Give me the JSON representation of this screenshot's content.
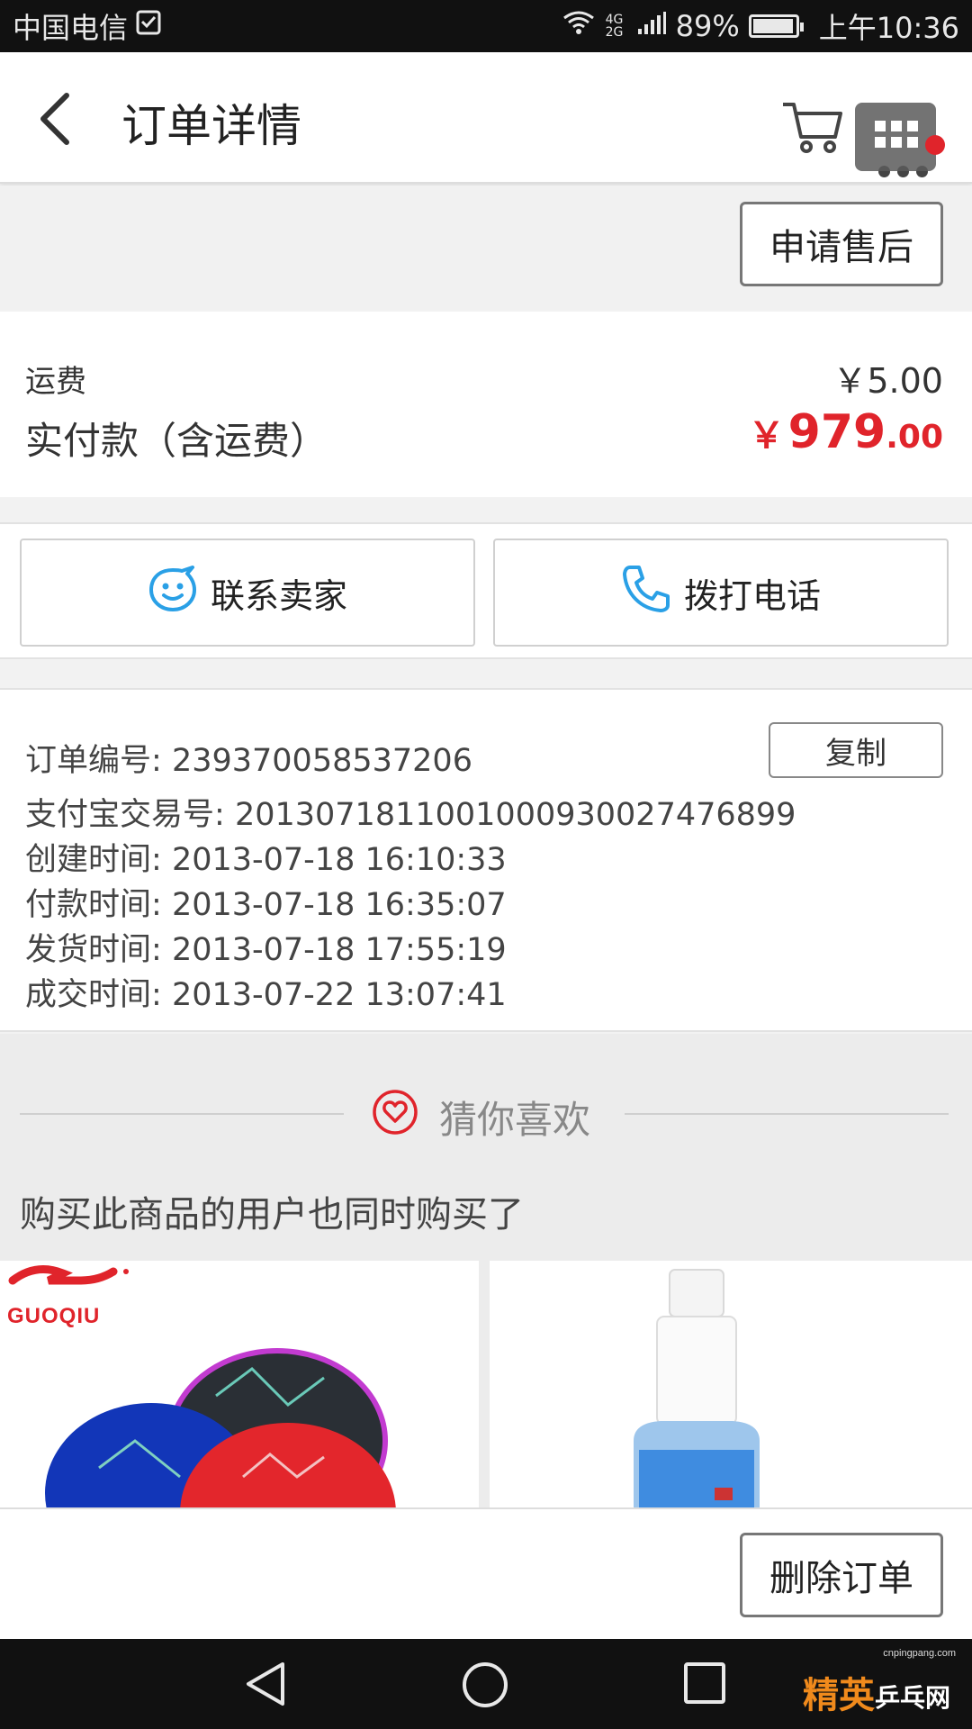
{
  "status_bar": {
    "carrier": "中国电信",
    "network": "4G 2G",
    "battery": "89%",
    "time": "上午10:36"
  },
  "header": {
    "title": "订单详情"
  },
  "actions": {
    "after_sale": "申请售后",
    "delete_order": "删除订单",
    "contact_seller": "联系卖家",
    "call_phone": "拨打电话",
    "copy": "复制"
  },
  "payment": {
    "shipping_label": "运费",
    "shipping_value": "￥5.00",
    "paid_label": "实付款（含运费）",
    "paid_symbol": "￥",
    "paid_integer": "979",
    "paid_decimal": ".00"
  },
  "order_info": [
    {
      "label": "订单编号:",
      "value": "239370058537206"
    },
    {
      "label": "支付宝交易号:",
      "value": "2013071811001000930027476899"
    },
    {
      "label": "创建时间:",
      "value": "2013-07-18 16:10:33"
    },
    {
      "label": "付款时间:",
      "value": "2013-07-18 16:35:07"
    },
    {
      "label": "发货时间:",
      "value": "2013-07-18 17:55:19"
    },
    {
      "label": "成交时间:",
      "value": "2013-07-22 13:07:41"
    }
  ],
  "recommend": {
    "title": "猜你喜欢",
    "subtitle": "购买此商品的用户也同时购买了",
    "brand_logo_text": "GUOQIU"
  },
  "watermark": {
    "line1": "精英",
    "line2": "乒乓网",
    "url": "cnpingpang.com"
  },
  "colors": {
    "price_red": "#e0242b",
    "icon_blue": "#2aa0e6",
    "heart_red": "#e0242b"
  }
}
